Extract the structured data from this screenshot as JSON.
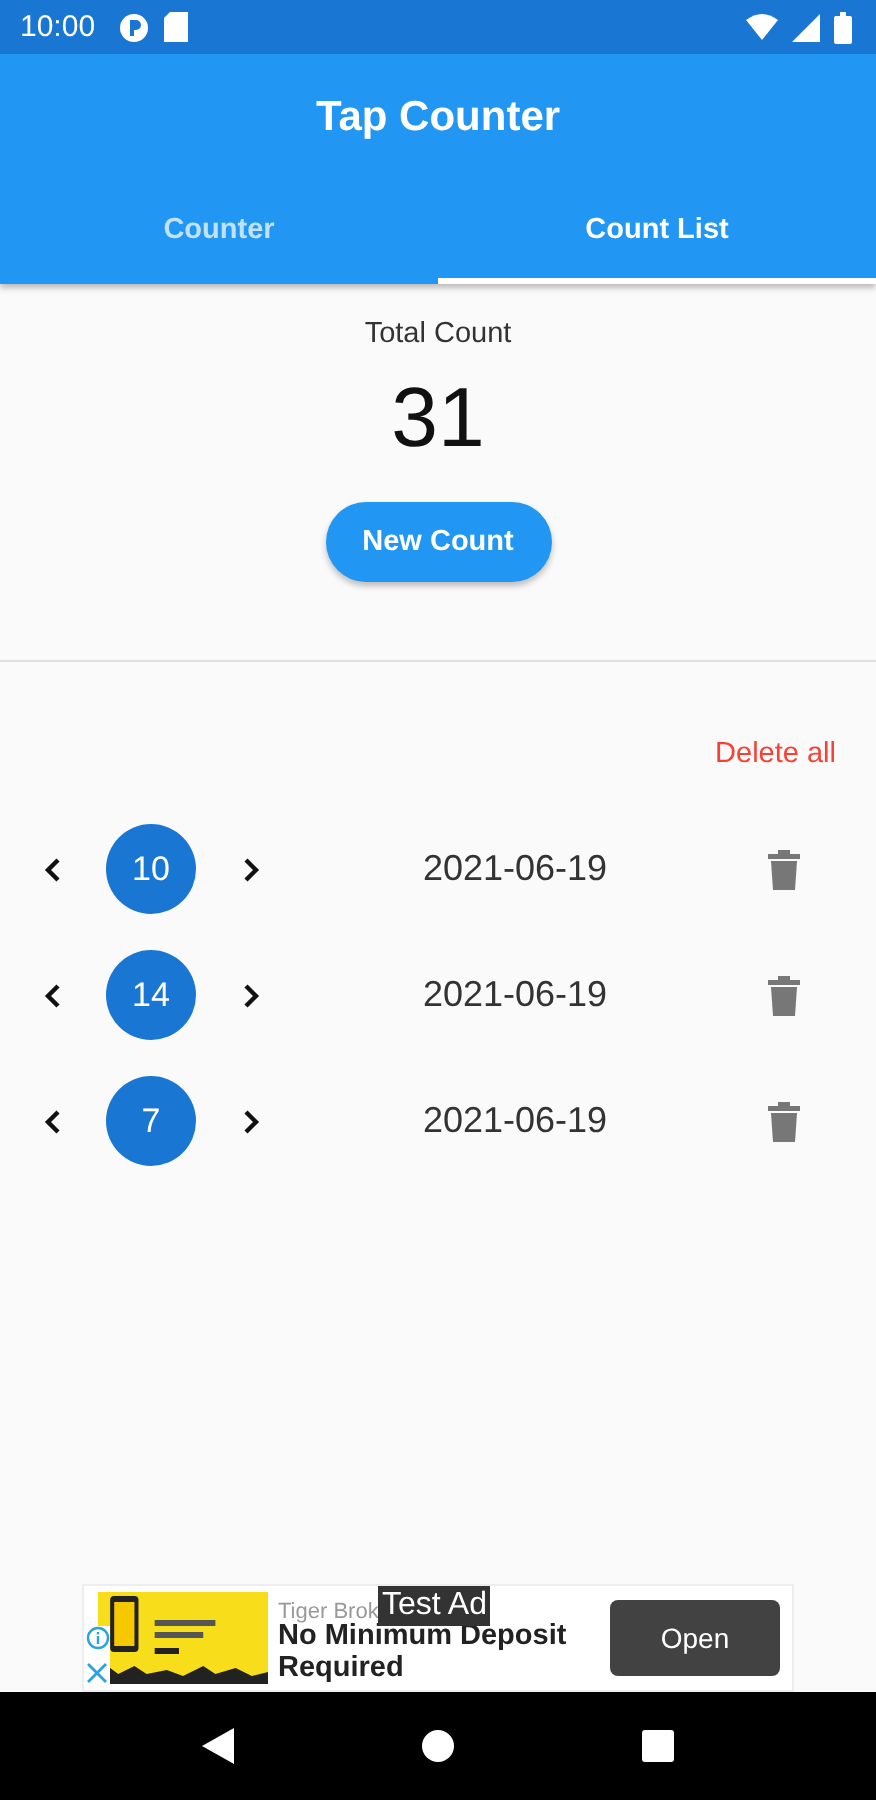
{
  "status_bar": {
    "time": "10:00"
  },
  "app_bar": {
    "title": "Tap Counter"
  },
  "tabs": [
    {
      "label": "Counter",
      "selected": false
    },
    {
      "label": "Count List",
      "selected": true
    }
  ],
  "total": {
    "label": "Total Count",
    "value": "31",
    "button": "New Count"
  },
  "delete_all": "Delete all",
  "counts": [
    {
      "value": "10",
      "date": "2021-06-19"
    },
    {
      "value": "14",
      "date": "2021-06-19"
    },
    {
      "value": "7",
      "date": "2021-06-19"
    }
  ],
  "ad": {
    "advertiser": "Tiger Brok",
    "badge": "Test Ad",
    "headline": "No Minimum Deposit Required",
    "button": "Open"
  }
}
